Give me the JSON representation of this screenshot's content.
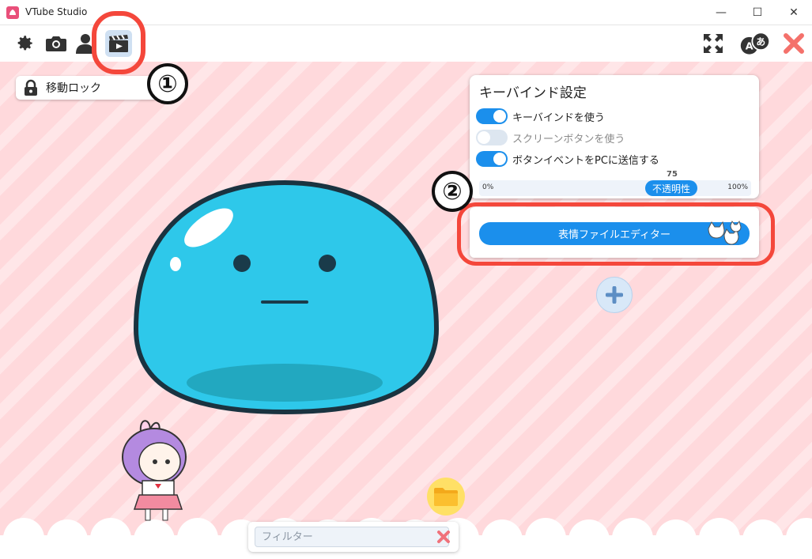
{
  "window": {
    "title": "VTube Studio",
    "controls": {
      "minimize": "—",
      "maximize": "☐",
      "close": "✕"
    }
  },
  "toolbar": {
    "left_icons": [
      "gear-icon",
      "camera-icon",
      "person-icon",
      "clapperboard-icon"
    ],
    "right_icons": [
      "fullscreen-icon",
      "language-icon",
      "exit-icon"
    ],
    "language_glyphs": {
      "latin": "A",
      "kana": "あ"
    }
  },
  "move_lock": {
    "label": "移動ロック"
  },
  "annotations": {
    "step1": "①",
    "step2": "②"
  },
  "hotkey_panel": {
    "title": "キーバインド設定",
    "toggles": [
      {
        "label": "キーバインドを使う",
        "on": true
      },
      {
        "label": "スクリーンボタンを使う",
        "on": false
      },
      {
        "label": "ボタンイベントをPCに送信する",
        "on": true
      }
    ],
    "opacity": {
      "min_label": "0%",
      "max_label": "100%",
      "value": "75",
      "thumb_label": "不透明性"
    }
  },
  "editor_button": {
    "label": "表情ファイルエディター"
  },
  "filter": {
    "placeholder": "フィルター"
  },
  "colors": {
    "accent": "#1b8fec",
    "annotation": "#f4473b",
    "stage_stripe": "#ffd9dc",
    "slime": "#2ec8ea"
  }
}
